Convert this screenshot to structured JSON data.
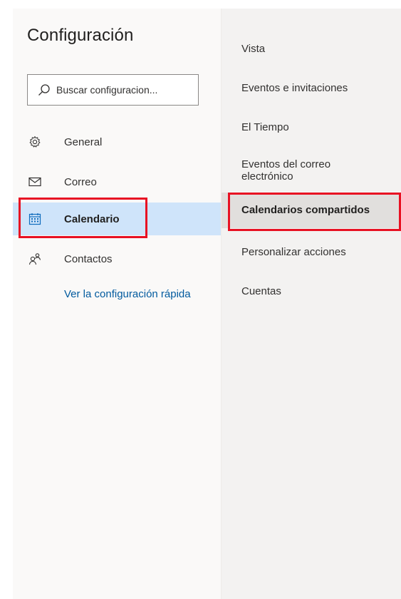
{
  "settings": {
    "title": "Configuración",
    "search": {
      "placeholder": "Buscar configuracion..."
    },
    "nav": [
      {
        "label": "General",
        "icon": "gear-icon"
      },
      {
        "label": "Correo",
        "icon": "mail-icon"
      },
      {
        "label": "Calendario",
        "icon": "calendar-icon",
        "selected": true
      },
      {
        "label": "Contactos",
        "icon": "people-icon"
      }
    ],
    "quick_settings_link": "Ver la configuración rápida"
  },
  "calendar_menu": {
    "items": [
      {
        "label": "Vista"
      },
      {
        "label": "Eventos e invitaciones"
      },
      {
        "label": "El Tiempo"
      },
      {
        "label": "Eventos del correo electrónico"
      },
      {
        "label": "Calendarios compartidos",
        "selected": true
      },
      {
        "label": "Personalizar acciones"
      },
      {
        "label": "Cuentas"
      }
    ]
  },
  "colors": {
    "selected_bg": "#cfe4fa",
    "link": "#005a9e",
    "highlight": "#e81123"
  }
}
